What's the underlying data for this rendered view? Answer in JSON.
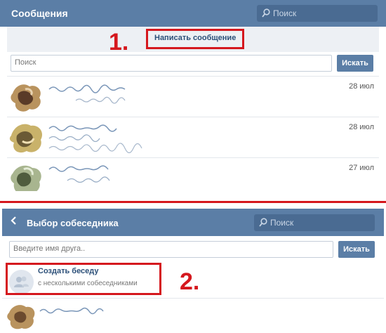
{
  "panel1": {
    "title": "Сообщения",
    "header_search_placeholder": "Поиск",
    "write_message_link": "Написать сообщение",
    "annotation_number": "1.",
    "search_placeholder": "Поиск",
    "search_button": "Искать",
    "dialogs": [
      {
        "date": "28 июл"
      },
      {
        "date": "28 июл"
      },
      {
        "date": "27 июл"
      }
    ]
  },
  "panel2": {
    "title": "Выбор собеседника",
    "header_search_placeholder": "Поиск",
    "friend_input_placeholder": "Введите имя друга..",
    "search_button": "Искать",
    "create_chat_title": "Создать беседу",
    "create_chat_subtitle": "с несколькими собеседниками",
    "annotation_number": "2."
  },
  "icons": {
    "search": "search-icon",
    "back": "chevron-left-icon",
    "group": "group-icon"
  },
  "colors": {
    "header": "#5b7ea6",
    "annotation": "#d5181e",
    "link": "#2b4f78"
  }
}
